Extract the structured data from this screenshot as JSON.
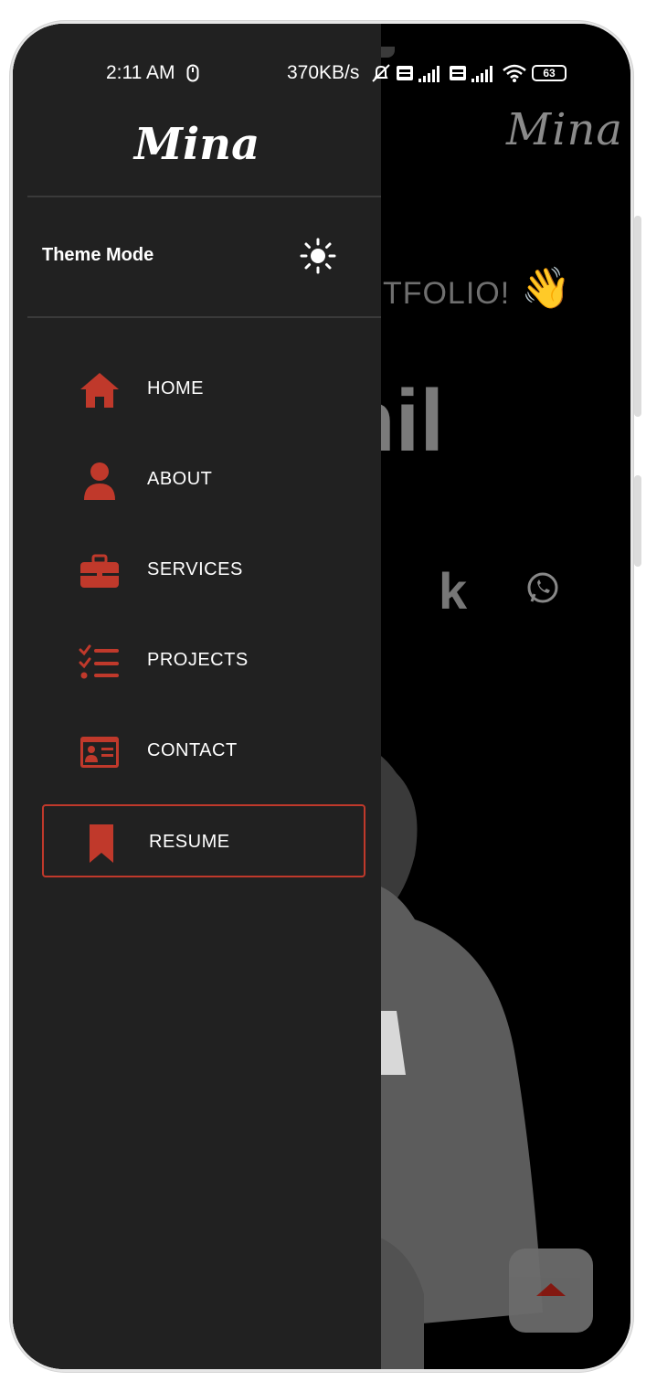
{
  "status_bar": {
    "time": "2:11 AM",
    "network_speed": "370KB/s",
    "battery": "63"
  },
  "drawer": {
    "logo": "Mina",
    "theme_mode_label": "Theme Mode",
    "theme_icon": "sun-icon",
    "nav": [
      {
        "label": "HOME",
        "icon": "home-icon"
      },
      {
        "label": "ABOUT",
        "icon": "user-icon"
      },
      {
        "label": "SERVICES",
        "icon": "briefcase-icon"
      },
      {
        "label": "PROJECTS",
        "icon": "tasks-list-icon"
      },
      {
        "label": "CONTACT",
        "icon": "id-card-icon"
      },
      {
        "label": "RESUME",
        "icon": "bookmark-icon",
        "active": true
      }
    ],
    "accent_color": "#c0392b"
  },
  "background_page": {
    "logo": "Mina",
    "welcome_fragment": "RTFOLIO!",
    "name_fragment": "nil",
    "social_fragment": "k",
    "scroll_top_icon": "arrow-up-icon"
  }
}
